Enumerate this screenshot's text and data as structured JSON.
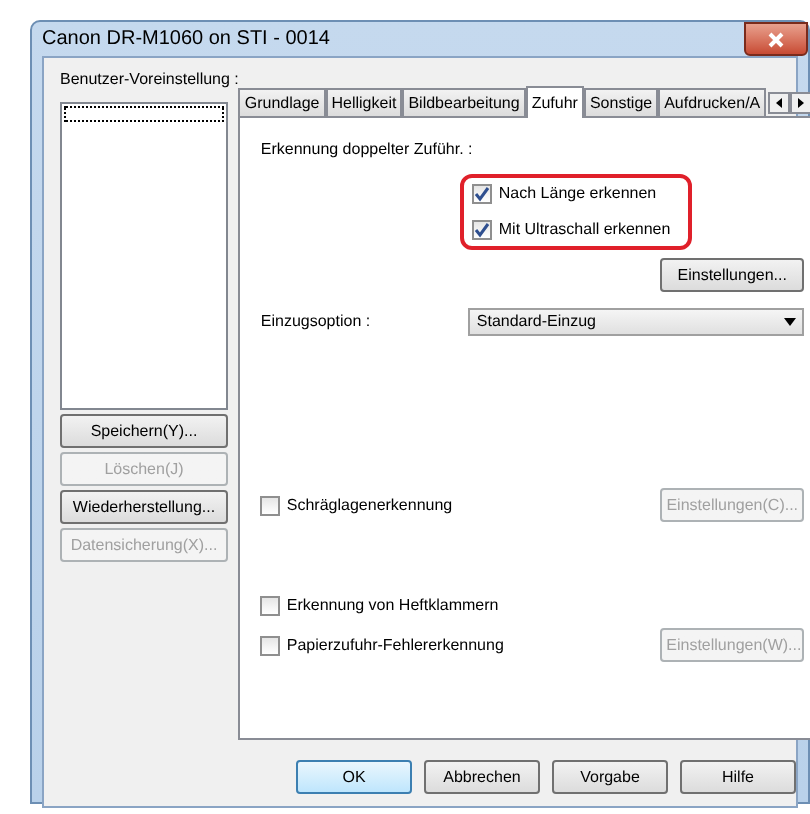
{
  "window": {
    "title": "Canon DR-M1060 on STI - 0014"
  },
  "presets": {
    "label": "Benutzer-Voreinstellung :",
    "buttons": [
      {
        "label": "Speichern(Y)...",
        "disabled": false
      },
      {
        "label": "Löschen(J)",
        "disabled": true
      },
      {
        "label": "Wiederherstellung...",
        "disabled": false
      },
      {
        "label": "Datensicherung(X)...",
        "disabled": true
      }
    ]
  },
  "tabs": [
    {
      "label": "Grundlage",
      "selected": false
    },
    {
      "label": "Helligkeit",
      "selected": false
    },
    {
      "label": "Bildbearbeitung",
      "selected": false
    },
    {
      "label": "Zufuhr",
      "selected": true
    },
    {
      "label": "Sonstige",
      "selected": false
    },
    {
      "label": "Aufdrucken/A",
      "selected": false
    }
  ],
  "double_feed": {
    "label": "Erkennung doppelter Zuführ. :",
    "options": [
      {
        "label": "Nach Länge erkennen",
        "checked": true
      },
      {
        "label": "Mit Ultraschall erkennen",
        "checked": true
      }
    ],
    "settings_button": "Einstellungen..."
  },
  "feed_option": {
    "label": "Einzugsoption :",
    "value": "Standard-Einzug"
  },
  "checks": [
    {
      "label": "Schräglagenerkennung",
      "checked": false,
      "button": {
        "label": "Einstellungen(C)...",
        "disabled": true
      }
    },
    {
      "label": "Erkennung von Heftklammern",
      "checked": false
    },
    {
      "label": "Papierzufuhr-Fehlererkennung",
      "checked": false,
      "button": {
        "label": "Einstellungen(W)...",
        "disabled": true
      }
    }
  ],
  "footer_buttons": [
    {
      "label": "OK",
      "default": true
    },
    {
      "label": "Abbrechen",
      "default": false
    },
    {
      "label": "Vorgabe",
      "default": false
    },
    {
      "label": "Hilfe",
      "default": false
    }
  ]
}
